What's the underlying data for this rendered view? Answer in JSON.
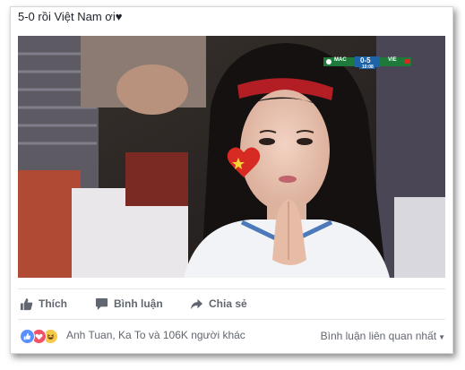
{
  "post": {
    "caption": "5-0 rồi Việt Nam ơi♥"
  },
  "video": {
    "scorebug": {
      "home_team": "MAC",
      "away_team": "VIE",
      "score": "0-5",
      "clock": "10:08"
    }
  },
  "actions": {
    "like_label": "Thích",
    "comment_label": "Bình luận",
    "share_label": "Chia sẻ"
  },
  "reactions": {
    "icons": [
      "like-icon",
      "love-icon",
      "haha-icon"
    ],
    "summary": "Anh Tuan, Ka To và 106K người khác",
    "comment_sort": "Bình luận liên quan nhất"
  },
  "colors": {
    "like_blue": "#5890ff",
    "love_red": "#f25268",
    "haha_yellow": "#f7c948",
    "text_gray": "#616770"
  }
}
